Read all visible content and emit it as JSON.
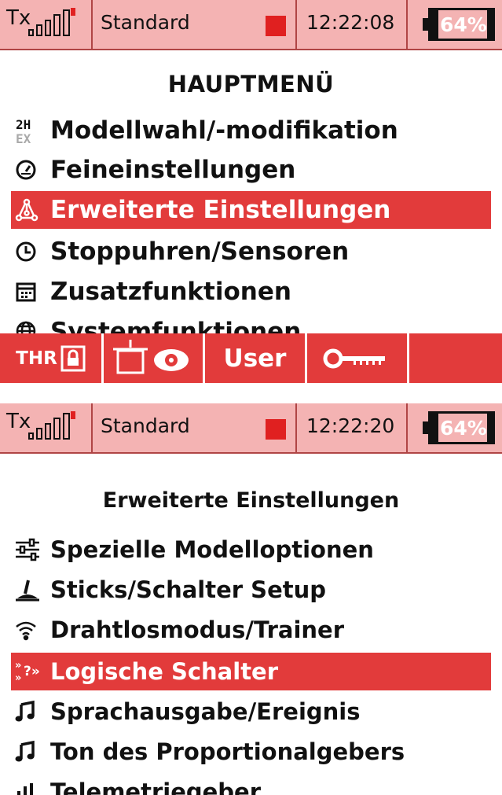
{
  "screen1": {
    "status": {
      "tx_label": "Tx",
      "model": "Standard",
      "time": "12:22:08",
      "battery_percent": "64%",
      "battery_level": 0.64
    },
    "title": "HAUPTMENÜ",
    "menu": [
      {
        "label": "Modellwahl/-modifikation",
        "icon": "model-select-icon"
      },
      {
        "label": "Feineinstellungen",
        "icon": "gauge-icon"
      },
      {
        "label": "Erweiterte Einstellungen",
        "icon": "network-icon",
        "selected": true
      },
      {
        "label": "Stoppuhren/Sensoren",
        "icon": "clock-icon"
      },
      {
        "label": "Zusatzfunktionen",
        "icon": "calendar-icon"
      },
      {
        "label": "Systemfunktionen",
        "icon": "globe-icon"
      }
    ],
    "bottombar": {
      "thr_label": "THR",
      "user_label": "User"
    }
  },
  "screen2": {
    "status": {
      "tx_label": "Tx",
      "model": "Standard",
      "time": "12:22:20",
      "battery_percent": "64%",
      "battery_level": 0.64
    },
    "title": "Erweiterte Einstellungen",
    "menu": [
      {
        "label": "Spezielle Modelloptionen",
        "icon": "sliders-icon"
      },
      {
        "label": "Sticks/Schalter Setup",
        "icon": "stick-icon"
      },
      {
        "label": "Drahtlosmodus/Trainer",
        "icon": "wifi-icon"
      },
      {
        "label": "Logische Schalter",
        "icon": "logic-switch-icon",
        "selected": true
      },
      {
        "label": "Sprachausgabe/Ereignis",
        "icon": "music-note-icon"
      },
      {
        "label": "Ton des Proportionalgebers",
        "icon": "music-note-icon"
      },
      {
        "label": "Telemetriegeber",
        "icon": "telemetry-icon"
      }
    ]
  },
  "colors": {
    "accent": "#e23b3b",
    "status_bg": "#f4b3b3",
    "record": "#e02020"
  }
}
